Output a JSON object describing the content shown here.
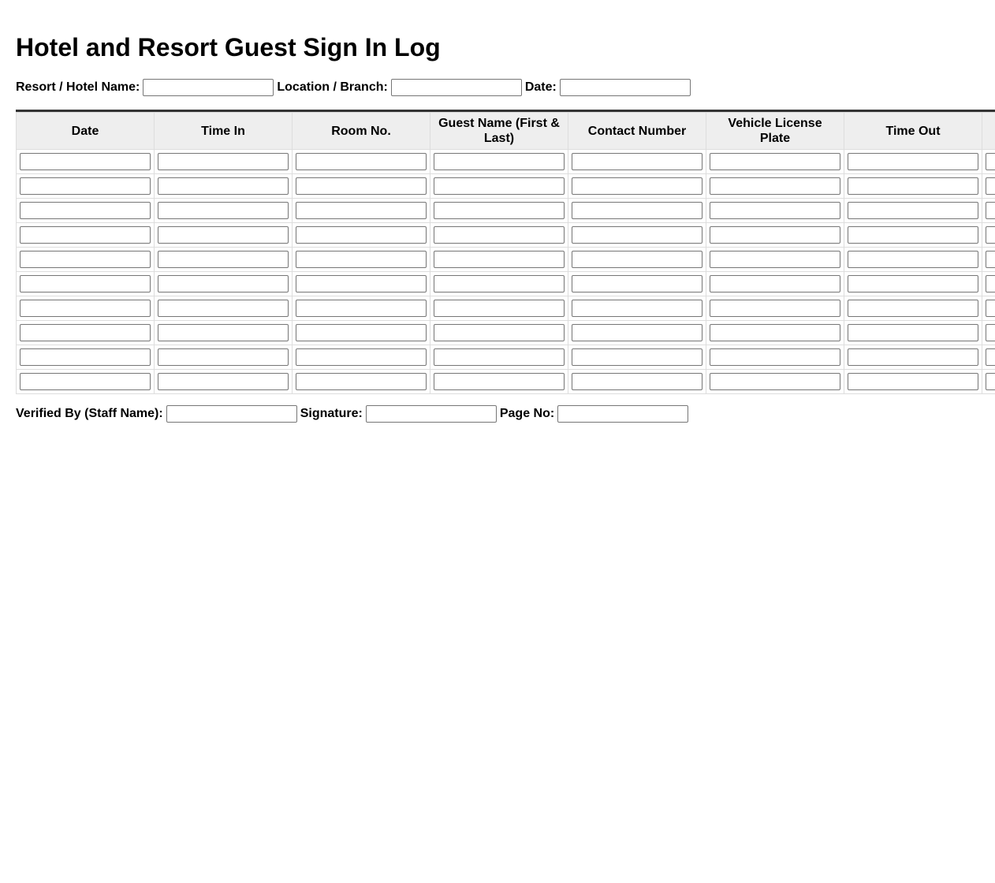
{
  "title": "Hotel and Resort Guest Sign In Log",
  "header_fields": [
    {
      "label": "Resort / Hotel Name:",
      "value": ""
    },
    {
      "label": "Location / Branch:",
      "value": ""
    },
    {
      "label": "Date:",
      "value": ""
    }
  ],
  "table": {
    "columns": [
      "Date",
      "Time In",
      "Room No.",
      "Guest Name (First & Last)",
      "Contact Number",
      "Vehicle License Plate",
      "Time Out",
      ""
    ],
    "rows": [
      [
        "",
        "",
        "",
        "",
        "",
        "",
        "",
        ""
      ],
      [
        "",
        "",
        "",
        "",
        "",
        "",
        "",
        ""
      ],
      [
        "",
        "",
        "",
        "",
        "",
        "",
        "",
        ""
      ],
      [
        "",
        "",
        "",
        "",
        "",
        "",
        "",
        ""
      ],
      [
        "",
        "",
        "",
        "",
        "",
        "",
        "",
        ""
      ],
      [
        "",
        "",
        "",
        "",
        "",
        "",
        "",
        ""
      ],
      [
        "",
        "",
        "",
        "",
        "",
        "",
        "",
        ""
      ],
      [
        "",
        "",
        "",
        "",
        "",
        "",
        "",
        ""
      ],
      [
        "",
        "",
        "",
        "",
        "",
        "",
        "",
        ""
      ],
      [
        "",
        "",
        "",
        "",
        "",
        "",
        "",
        ""
      ]
    ]
  },
  "footer_fields": [
    {
      "label": "Verified By (Staff Name):",
      "value": ""
    },
    {
      "label": "Signature:",
      "value": ""
    },
    {
      "label": "Page No:",
      "value": ""
    }
  ],
  "colors": {
    "header_bg": "#eeeeee",
    "top_rule": "#333333",
    "grid_line": "#dddddd"
  }
}
